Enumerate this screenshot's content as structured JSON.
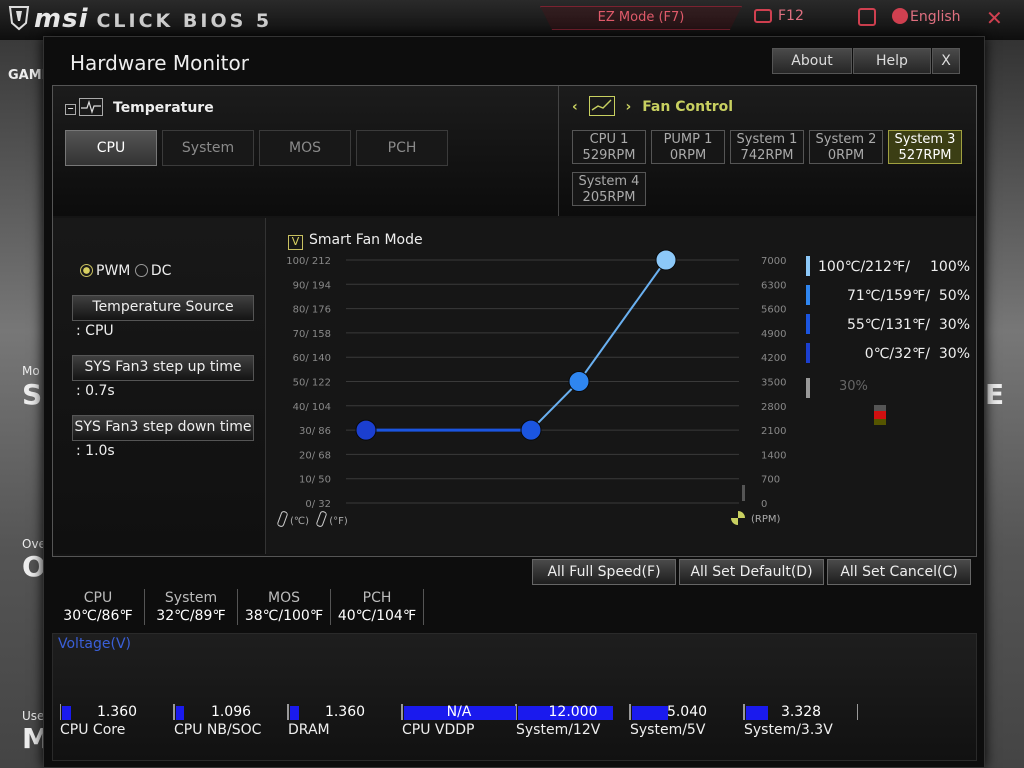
{
  "header": {
    "brand": "msi",
    "product": "CLICK BIOS 5",
    "ez_mode": "EZ Mode (F7)",
    "f12": "F12",
    "language": "English",
    "close": "✕"
  },
  "background": {
    "left_texts": [
      "GAMI",
      "Mo",
      "SI",
      "Ove",
      "O",
      "Use",
      "M"
    ],
    "right_texts": [
      "E"
    ]
  },
  "modal": {
    "title": "Hardware Monitor",
    "about": "About",
    "help": "Help",
    "close": "X"
  },
  "temperature": {
    "label": "Temperature",
    "tabs": [
      "CPU",
      "System",
      "MOS",
      "PCH"
    ],
    "active_tab": "CPU"
  },
  "fan_control": {
    "label": "Fan Control",
    "fans": [
      {
        "name": "CPU 1",
        "rpm": "529RPM"
      },
      {
        "name": "PUMP 1",
        "rpm": "0RPM"
      },
      {
        "name": "System 1",
        "rpm": "742RPM"
      },
      {
        "name": "System 2",
        "rpm": "0RPM"
      },
      {
        "name": "System 3",
        "rpm": "527RPM"
      },
      {
        "name": "System 4",
        "rpm": "205RPM"
      }
    ],
    "active_fan": "System 3"
  },
  "mode": {
    "pwm": "PWM",
    "dc": "DC",
    "selected": "PWM",
    "temp_source_label": "Temperature Source",
    "temp_source_value": ": CPU",
    "step_up_label": "SYS Fan3 step up time",
    "step_up_value": ": 0.7s",
    "step_down_label": "SYS Fan3 step down time",
    "step_down_value": ": 1.0s"
  },
  "smart_fan": {
    "label": "Smart Fan Mode",
    "checked": true,
    "check_mark": "V",
    "current_percent": "30%"
  },
  "chart_data": {
    "type": "line",
    "y_left_ticks": [
      "100/ 212",
      "90/ 194",
      "80/ 176",
      "70/ 158",
      "60/ 140",
      "50/ 122",
      "40/ 104",
      "30/  86",
      "20/  68",
      "10/  50",
      "0/  32"
    ],
    "y_right_ticks": [
      "7000",
      "6300",
      "5600",
      "4900",
      "4200",
      "3500",
      "2800",
      "2100",
      "1400",
      "700",
      "0"
    ],
    "x_unit_c": "(℃)",
    "x_unit_f": "(°F)",
    "rpm_unit": "(RPM)",
    "points": [
      {
        "temp_c": 0,
        "percent": 30
      },
      {
        "temp_c": 55,
        "percent": 30
      },
      {
        "temp_c": 71,
        "percent": 50
      },
      {
        "temp_c": 100,
        "percent": 100
      }
    ],
    "point_colors": [
      "#1b3fd0",
      "#1b55e0",
      "#2f86f0",
      "#8cc8f8"
    ],
    "legend": [
      {
        "temp": "100℃/212℉/",
        "percent": "100%",
        "color": "#8cc8f8"
      },
      {
        "temp": "71℃/159℉/",
        "percent": "50%",
        "color": "#2f86f0"
      },
      {
        "temp": "55℃/131℉/",
        "percent": "30%",
        "color": "#1b55e0"
      },
      {
        "temp": "0℃/32℉/",
        "percent": "30%",
        "color": "#1b3fd0"
      }
    ],
    "ylim": [
      0,
      100
    ],
    "grid": true
  },
  "actions": {
    "full_speed": "All Full Speed(F)",
    "set_default": "All Set Default(D)",
    "set_cancel": "All Set Cancel(C)"
  },
  "temps": [
    {
      "name": "CPU",
      "value": "30℃/86℉"
    },
    {
      "name": "System",
      "value": "32℃/89℉"
    },
    {
      "name": "MOS",
      "value": "38℃/100℉"
    },
    {
      "name": "PCH",
      "value": "40℃/104℉"
    }
  ],
  "voltage": {
    "title": "Voltage(V)",
    "items": [
      {
        "name": "CPU Core",
        "value": "1.360",
        "fill": 0.08
      },
      {
        "name": "CPU NB/SOC",
        "value": "1.096",
        "fill": 0.07
      },
      {
        "name": "DRAM",
        "value": "1.360",
        "fill": 0.08
      },
      {
        "name": "CPU VDDP",
        "value": "N/A",
        "fill": 1.0
      },
      {
        "name": "System/12V",
        "value": "12.000",
        "fill": 0.85
      },
      {
        "name": "System/5V",
        "value": "5.040",
        "fill": 0.32
      },
      {
        "name": "System/3.3V",
        "value": "3.328",
        "fill": 0.2
      }
    ]
  }
}
